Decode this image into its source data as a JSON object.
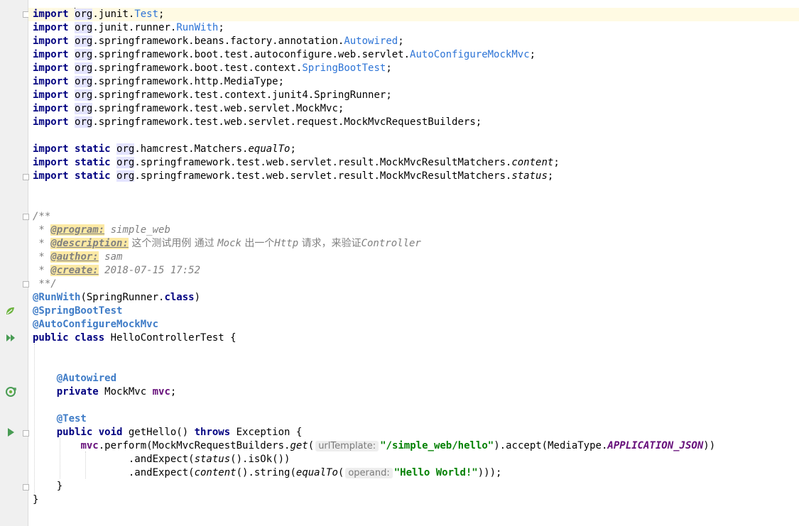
{
  "editor": {
    "lines": {
      "l1": {
        "kw": "import",
        "pkg": "org",
        "rest": ".junit.",
        "cls": "Test",
        "end": ";"
      },
      "l2": {
        "kw": "import",
        "pkg": "org",
        "rest": ".junit.runner.",
        "cls": "RunWith",
        "end": ";"
      },
      "l3": {
        "kw": "import",
        "pkg": "org",
        "rest": ".springframework.beans.factory.annotation.",
        "cls": "Autowired",
        "end": ";"
      },
      "l4": {
        "kw": "import",
        "pkg": "org",
        "rest": ".springframework.boot.test.autoconfigure.web.servlet.",
        "cls": "AutoConfigureMockMvc",
        "end": ";"
      },
      "l5": {
        "kw": "import",
        "pkg": "org",
        "rest": ".springframework.boot.test.context.",
        "cls": "SpringBootTest",
        "end": ";"
      },
      "l6": {
        "kw": "import",
        "pkg": "org",
        "rest": ".springframework.http.MediaType;"
      },
      "l7": {
        "kw": "import",
        "pkg": "org",
        "rest": ".springframework.test.context.junit4.SpringRunner;"
      },
      "l8": {
        "kw": "import",
        "pkg": "org",
        "rest": ".springframework.test.web.servlet.MockMvc;"
      },
      "l9": {
        "kw": "import",
        "pkg": "org",
        "rest": ".springframework.test.web.servlet.request.MockMvcRequestBuilders;"
      },
      "l11": {
        "kw": "import static",
        "pkg": "org",
        "rest": ".hamcrest.Matchers.",
        "it": "equalTo",
        "end": ";"
      },
      "l12": {
        "kw": "import static",
        "pkg": "org",
        "rest": ".springframework.test.web.servlet.result.MockMvcResultMatchers.",
        "it": "content",
        "end": ";"
      },
      "l13": {
        "kw": "import static",
        "pkg": "org",
        "rest": ".springframework.test.web.servlet.result.MockMvcResultMatchers.",
        "it": "status",
        "end": ";"
      },
      "l16": {
        "text": "/**"
      },
      "l17": {
        "star": " * ",
        "tag": "@program:",
        "val": " simple_web"
      },
      "l18": {
        "star": " * ",
        "tag": "@description:",
        "cjk1": " 这个测试用例 通过 ",
        "mid": "Mock",
        "cjk2": " 出一个",
        "http": "Http",
        "cjk3": " 请求，来验证",
        "ctrl": "Controller"
      },
      "l19": {
        "star": " * ",
        "tag": "@author:",
        "val": " sam"
      },
      "l20": {
        "star": " * ",
        "tag": "@create:",
        "val": " 2018-07-15 17:52"
      },
      "l21": {
        "text": " **/"
      },
      "l22": {
        "ann": "@RunWith",
        "open": "(SpringRunner.",
        "kw": "class",
        "close": ")"
      },
      "l23": {
        "ann": "@SpringBootTest"
      },
      "l24": {
        "ann": "@AutoConfigureMockMvc"
      },
      "l25": {
        "kw": "public class",
        "rest": " HelloControllerTest {"
      },
      "l28": {
        "indent": "    ",
        "ann": "@Autowired"
      },
      "l29": {
        "indent": "    ",
        "kw": "private",
        "type": " MockMvc ",
        "field": "mvc",
        "end": ";"
      },
      "l31": {
        "indent": "    ",
        "ann": "@Test"
      },
      "l32": {
        "indent": "    ",
        "kw": "public void",
        "mid": " getHello() ",
        "kw2": "throws",
        "rest": " Exception {"
      },
      "l33": {
        "indent": "        ",
        "field": "mvc",
        "a": ".perform(MockMvcRequestBuilders.",
        "it": "get",
        "b": "(",
        "hint": "urlTemplate:",
        "str": "\"/simple_web/hello\"",
        "c": ").accept(MediaType.",
        "const": "APPLICATION_JSON",
        "d": "))"
      },
      "l34": {
        "indent": "                ",
        "a": ".andExpect(",
        "it": "status",
        "b": "().isOk())"
      },
      "l35": {
        "indent": "                ",
        "a": ".andExpect(",
        "it": "content",
        "b": "().string(",
        "it2": "equalTo",
        "c": "(",
        "hint": "operand:",
        "str": "\"Hello World!\"",
        "d": ")));"
      },
      "l36": {
        "text": "    }"
      },
      "l37": {
        "text": "}"
      }
    },
    "gutter_icons": {
      "spring": "spring-leaf-icon",
      "run_class": "run-class-icon",
      "autowired": "autowired-bean-icon",
      "run_test": "run-test-icon"
    }
  },
  "colors": {
    "keyword": "#000080",
    "annotation": "#3f7cc7",
    "string": "#008000",
    "comment": "#808080",
    "field": "#660e7a",
    "gutter": "#f0f0f0",
    "current_line": "#fffae3",
    "spring_green": "#6db33f",
    "run_green": "#499c54"
  }
}
